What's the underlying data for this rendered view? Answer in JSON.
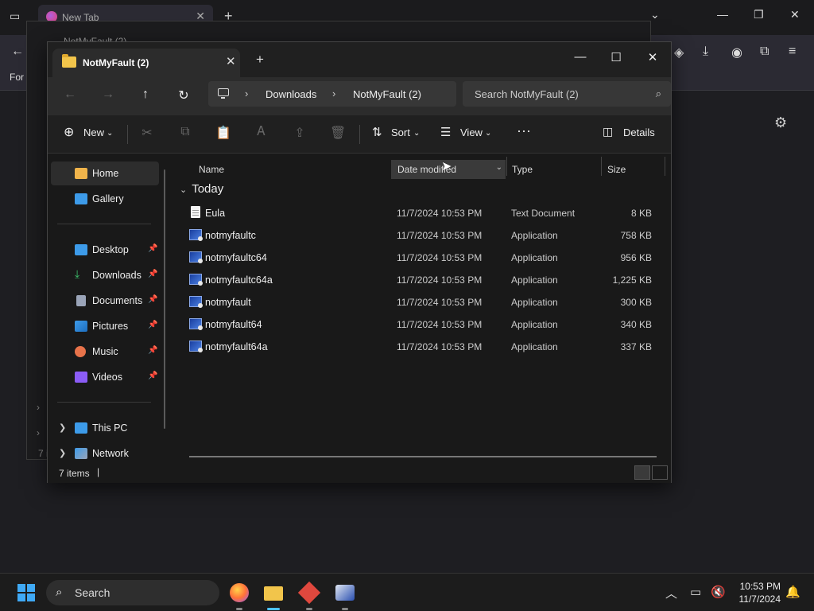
{
  "browser": {
    "tab_title": "New Tab",
    "partial_text": "For"
  },
  "ghost_window": {
    "tab_title": "NotMyFault (2)",
    "status_partial": "7 i"
  },
  "explorer": {
    "tab_title": "NotMyFault (2)",
    "breadcrumb": [
      "Downloads",
      "NotMyFault (2)"
    ],
    "search_placeholder": "Search NotMyFault (2)",
    "commands": {
      "new": "New",
      "sort": "Sort",
      "view": "View",
      "details": "Details"
    },
    "sidebar": {
      "home": "Home",
      "gallery": "Gallery",
      "quick_access": [
        {
          "label": "Desktop",
          "icon": "desktop-icon",
          "color": "#3d9be9"
        },
        {
          "label": "Downloads",
          "icon": "downloads-icon",
          "color": "#3ec46d"
        },
        {
          "label": "Documents",
          "icon": "documents-icon",
          "color": "#9aa4b8"
        },
        {
          "label": "Pictures",
          "icon": "pictures-icon",
          "color": "#3d9be9"
        },
        {
          "label": "Music",
          "icon": "music-icon",
          "color": "#e8734a"
        },
        {
          "label": "Videos",
          "icon": "videos-icon",
          "color": "#8b5cf6"
        }
      ],
      "this_pc": "This PC",
      "network": "Network"
    },
    "columns": {
      "name": "Name",
      "date": "Date modified",
      "type": "Type",
      "size": "Size"
    },
    "group_label": "Today",
    "files": [
      {
        "name": "Eula",
        "date": "11/7/2024 10:53 PM",
        "type": "Text Document",
        "size": "8 KB",
        "kind": "doc"
      },
      {
        "name": "notmyfaultc",
        "date": "11/7/2024 10:53 PM",
        "type": "Application",
        "size": "758 KB",
        "kind": "app"
      },
      {
        "name": "notmyfaultc64",
        "date": "11/7/2024 10:53 PM",
        "type": "Application",
        "size": "956 KB",
        "kind": "app"
      },
      {
        "name": "notmyfaultc64a",
        "date": "11/7/2024 10:53 PM",
        "type": "Application",
        "size": "1,225 KB",
        "kind": "app"
      },
      {
        "name": "notmyfault",
        "date": "11/7/2024 10:53 PM",
        "type": "Application",
        "size": "300 KB",
        "kind": "app"
      },
      {
        "name": "notmyfault64",
        "date": "11/7/2024 10:53 PM",
        "type": "Application",
        "size": "340 KB",
        "kind": "app"
      },
      {
        "name": "notmyfault64a",
        "date": "11/7/2024 10:53 PM",
        "type": "Application",
        "size": "337 KB",
        "kind": "app"
      }
    ],
    "status": "7 items"
  },
  "taskbar": {
    "search_label": "Search",
    "time": "10:53 PM",
    "date": "11/7/2024"
  }
}
